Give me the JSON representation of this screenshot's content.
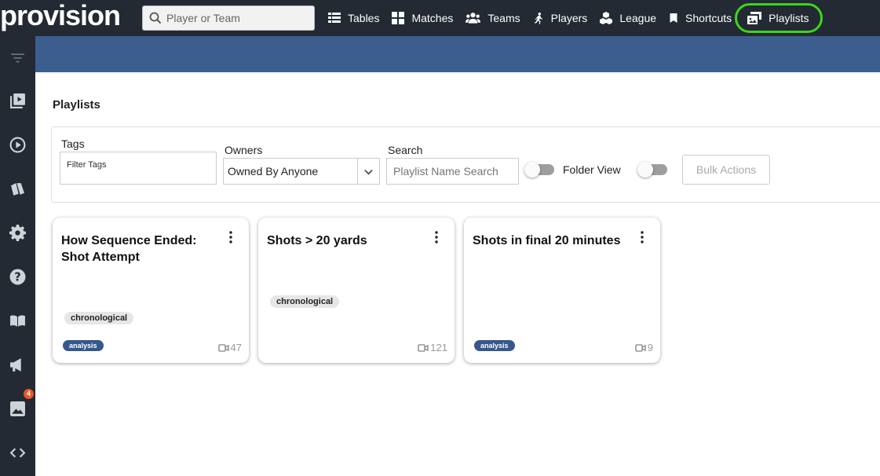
{
  "app": {
    "logo": "provision"
  },
  "search": {
    "placeholder": "Player or Team"
  },
  "nav": [
    {
      "label": "Tables",
      "icon": "table-icon"
    },
    {
      "label": "Matches",
      "icon": "grid-icon"
    },
    {
      "label": "Teams",
      "icon": "users-icon"
    },
    {
      "label": "Players",
      "icon": "runner-icon"
    },
    {
      "label": "League",
      "icon": "cubes-icon"
    },
    {
      "label": "Shortcuts",
      "icon": "bookmark-icon"
    },
    {
      "label": "Playlists",
      "icon": "photo-video-icon",
      "active": true
    }
  ],
  "sidebar": {
    "icons": [
      "filter-icon",
      "video-library-icon",
      "play-circle-icon",
      "cards-icon",
      "gear-icon",
      "help-icon",
      "book-icon",
      "megaphone-icon",
      "image-icon",
      "code-icon"
    ],
    "notification_count": "4"
  },
  "page": {
    "title": "Playlists"
  },
  "filters": {
    "tags_label": "Tags",
    "tags_placeholder": "Filter Tags",
    "owners_label": "Owners",
    "owners_value": "Owned By Anyone",
    "search_label": "Search",
    "search_placeholder": "Playlist Name Search",
    "folder_view_label": "Folder View",
    "bulk_actions_label": "Bulk Actions"
  },
  "playlists": [
    {
      "title": "How Sequence Ended: Shot Attempt",
      "tag": "chronological",
      "owner_tag": "analysis",
      "count": "47"
    },
    {
      "title": "Shots > 20 yards",
      "tag": "chronological",
      "owner_tag": "",
      "count": "121"
    },
    {
      "title": "Shots in final 20 minutes",
      "tag": "",
      "owner_tag": "analysis",
      "count": "9"
    }
  ],
  "colors": {
    "topbar": "#232a33",
    "banner": "#3b5e8f",
    "active_ring": "#3cd61d",
    "tag_blue": "#35578c"
  }
}
